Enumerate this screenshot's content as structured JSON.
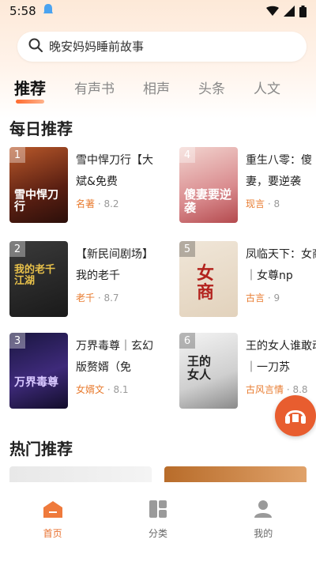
{
  "status": {
    "time": "5:58"
  },
  "search": {
    "placeholder": "晚安妈妈睡前故事"
  },
  "tabs": [
    {
      "label": "推荐"
    },
    {
      "label": "有声书"
    },
    {
      "label": "相声"
    },
    {
      "label": "头条"
    },
    {
      "label": "人文"
    }
  ],
  "daily": {
    "title": "每日推荐",
    "books": [
      {
        "rank": "1",
        "title": "雪中悍刀行【大斌&免费",
        "category": "名著",
        "score": "8.2",
        "cover_text": "雪中悍刀行",
        "color": "#7a2b17"
      },
      {
        "rank": "4",
        "title": "重生八零：傻妻，要逆袭",
        "category": "现言",
        "score": "8",
        "cover_text": "傻妻要逆袭",
        "color": "#d98b8e"
      },
      {
        "rank": "2",
        "title": "【新民间剧场】我的老千",
        "category": "老千",
        "score": "8.7",
        "cover_text": "我的老千江湖",
        "color": "#2a2a2a"
      },
      {
        "rank": "5",
        "title": "凤临天下：女商｜女尊np",
        "category": "古言",
        "score": "9",
        "cover_text": "女商",
        "color": "#a4221e"
      },
      {
        "rank": "3",
        "title": "万界毒尊｜玄幻版赘婿（免",
        "category": "女婿文",
        "score": "8.1",
        "cover_text": "万界毒尊",
        "color": "#2b1e5a"
      },
      {
        "rank": "6",
        "title": "王的女人谁敢动｜一刀苏",
        "category": "古风言情",
        "score": "8.8",
        "cover_text": "王的女人",
        "color": "#d8d8d8"
      }
    ]
  },
  "hot": {
    "title": "热门推荐"
  },
  "nav": [
    {
      "label": "首页"
    },
    {
      "label": "分类"
    },
    {
      "label": "我的"
    }
  ]
}
